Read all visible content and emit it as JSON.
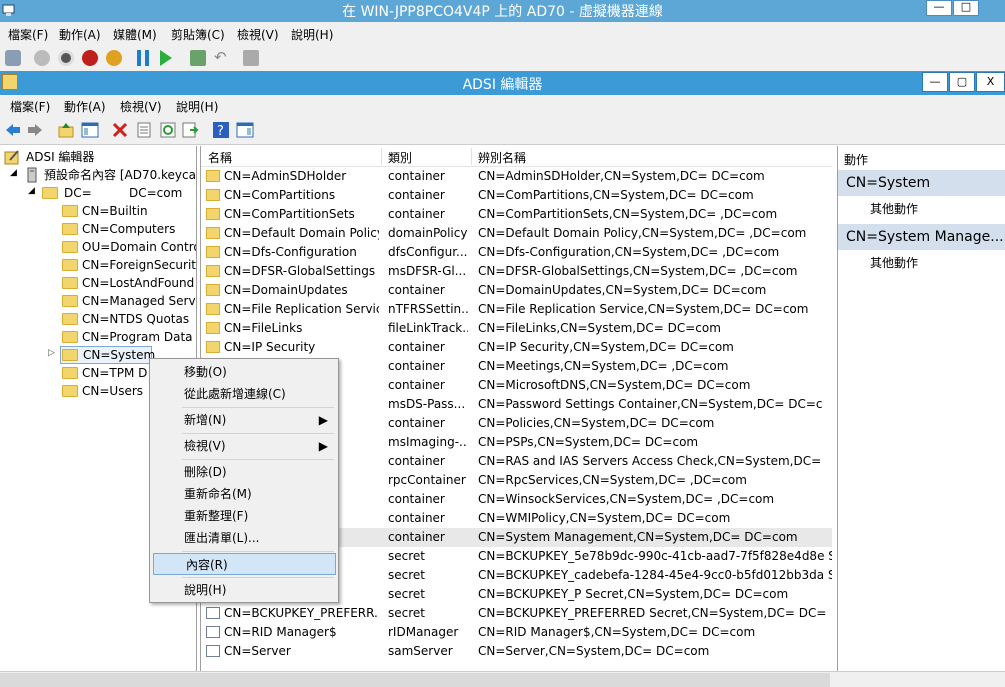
{
  "vm": {
    "title": "在 WIN-JPP8PCO4V4P 上的 AD70 - 虛擬機器連線",
    "window_controls": [
      "—",
      "□"
    ],
    "menu": [
      "檔案(F)",
      "動作(A)",
      "媒體(M)",
      "剪貼簿(C)",
      "檢視(V)",
      "說明(H)"
    ]
  },
  "adsi": {
    "title": "ADSI 編輯器",
    "window_controls": [
      "—",
      "▢",
      "X"
    ],
    "menu": [
      "檔案(F)",
      "動作(A)",
      "檢視(V)",
      "說明(H)"
    ]
  },
  "tree": {
    "root": "ADSI 編輯器",
    "context": "預設命名內容 [AD70.keycat",
    "domain_a": "DC=",
    "domain_b": "DC=com",
    "children": [
      "CN=Builtin",
      "CN=Computers",
      "OU=Domain Contro",
      "CN=ForeignSecurity",
      "CN=LostAndFound",
      "CN=Managed Serv",
      "CN=NTDS Quotas",
      "CN=Program Data",
      "CN=System",
      "CN=TPM D",
      "CN=Users"
    ]
  },
  "list": {
    "headers": [
      "名稱",
      "類別",
      "辨別名稱"
    ],
    "rows": [
      {
        "name": "CN=AdminSDHolder",
        "cls": "container",
        "dn": "CN=AdminSDHolder,CN=System,DC=            DC=com"
      },
      {
        "name": "CN=ComPartitions",
        "cls": "container",
        "dn": "CN=ComPartitions,CN=System,DC=            DC=com"
      },
      {
        "name": "CN=ComPartitionSets",
        "cls": "container",
        "dn": "CN=ComPartitionSets,CN=System,DC=          ,DC=com"
      },
      {
        "name": "CN=Default Domain Policy",
        "cls": "domainPolicy",
        "dn": "CN=Default Domain Policy,CN=System,DC=          ,DC=com"
      },
      {
        "name": "CN=Dfs-Configuration",
        "cls": "dfsConfigur...",
        "dn": "CN=Dfs-Configuration,CN=System,DC=          ,DC=com"
      },
      {
        "name": "CN=DFSR-GlobalSettings",
        "cls": "msDFSR-Gl...",
        "dn": "CN=DFSR-GlobalSettings,CN=System,DC=          ,DC=com"
      },
      {
        "name": "CN=DomainUpdates",
        "cls": "container",
        "dn": "CN=DomainUpdates,CN=System,DC=            DC=com"
      },
      {
        "name": "CN=File Replication Service",
        "cls": "nTFRSSettin...",
        "dn": "CN=File Replication Service,CN=System,DC=            DC=com"
      },
      {
        "name": "CN=FileLinks",
        "cls": "fileLinkTrack...",
        "dn": "CN=FileLinks,CN=System,DC=            DC=com"
      },
      {
        "name": "CN=IP Security",
        "cls": "container",
        "dn": "CN=IP Security,CN=System,DC=            DC=com"
      },
      {
        "name": "",
        "cls": "container",
        "dn": "CN=Meetings,CN=System,DC=          ,DC=com"
      },
      {
        "name": "",
        "cls": "container",
        "dn": "CN=MicrosoftDNS,CN=System,DC=            DC=com"
      },
      {
        "name": "gs Co...",
        "cls": "msDS-Pass...",
        "dn": "CN=Password Settings Container,CN=System,DC=            DC=c"
      },
      {
        "name": "",
        "cls": "container",
        "dn": "CN=Policies,CN=System,DC=            DC=com"
      },
      {
        "name": "",
        "cls": "msImaging-...",
        "dn": "CN=PSPs,CN=System,DC=            DC=com"
      },
      {
        "name": "rvers ...",
        "cls": "container",
        "dn": "CN=RAS and IAS Servers Access Check,CN=System,DC="
      },
      {
        "name": "",
        "cls": "rpcContainer",
        "dn": "CN=RpcServices,CN=System,DC=          ,DC=com"
      },
      {
        "name": "s",
        "cls": "container",
        "dn": "CN=WinsockServices,CN=System,DC=          ,DC=com"
      },
      {
        "name": "",
        "cls": "container",
        "dn": "CN=WMIPolicy,CN=System,DC=            DC=com"
      },
      {
        "name": "ement",
        "cls": "container",
        "dn": "CN=System Management,CN=System,DC=            DC=com"
      },
      {
        "name": "8b9d...",
        "cls": "secret",
        "dn": "CN=BCKUPKEY_5e78b9dc-990c-41cb-aad7-7f5f828e4d8e Sec"
      },
      {
        "name": "ebefa...",
        "cls": "secret",
        "dn": "CN=BCKUPKEY_cadebefa-1284-45e4-9cc0-b5fd012bb3da Sec"
      },
      {
        "name": "cret",
        "cls": "secret",
        "dn": "CN=BCKUPKEY_P Secret,CN=System,DC=            DC=com"
      },
      {
        "name": "CN=BCKUPKEY_PREFERR...",
        "cls": "secret",
        "dn": "CN=BCKUPKEY_PREFERRED Secret,CN=System,DC=            DC="
      },
      {
        "name": "CN=RID Manager$",
        "cls": "rIDManager",
        "dn": "CN=RID Manager$,CN=System,DC=            DC=com"
      },
      {
        "name": "CN=Server",
        "cls": "samServer",
        "dn": "CN=Server,CN=System,DC=            DC=com"
      }
    ]
  },
  "actions": {
    "header": "動作",
    "group1": "CN=System",
    "group1_item": "其他動作",
    "group2": "CN=System Manage...",
    "group2_item": "其他動作"
  },
  "context_menu": {
    "items": [
      "移動(O)",
      "從此處新增連線(C)",
      "新增(N)",
      "檢視(V)",
      "刪除(D)",
      "重新命名(M)",
      "重新整理(F)",
      "匯出清單(L)...",
      "內容(R)",
      "說明(H)"
    ],
    "highlighted": "內容(R)"
  },
  "colors": {
    "vm_title": "#5da7d6",
    "adsi_title": "#3c9bd7",
    "action_group": "#d4dfee",
    "highlight": "#d3e6f7"
  }
}
